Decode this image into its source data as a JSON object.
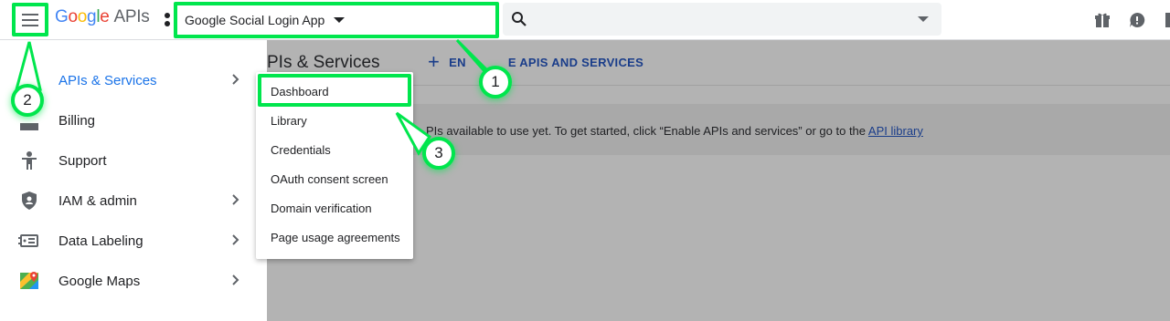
{
  "header": {
    "logo_google_letters": [
      "G",
      "o",
      "o",
      "g",
      "l",
      "e"
    ],
    "logo_apis": "APIs",
    "project_name": "Google Social Login App",
    "icons": [
      "menu-icon",
      "search-icon",
      "gift-icon",
      "notification-icon",
      "more-icon"
    ]
  },
  "content": {
    "page_title": "PIs & Services",
    "enable_plus": "+",
    "enable_label": "EN",
    "enable_label_end": "E APIS AND SERVICES",
    "info_text": "PIs available to use yet. To get started, click “Enable APIs and services” or go to the ",
    "info_link": "API library"
  },
  "nav": {
    "items": [
      {
        "label": "APIs & Services",
        "icon": "api-icon",
        "has_submenu": true,
        "active": true
      },
      {
        "label": "Billing",
        "icon": "billing-icon",
        "has_submenu": false
      },
      {
        "label": "Support",
        "icon": "support-icon",
        "has_submenu": false
      },
      {
        "label": "IAM & admin",
        "icon": "shield-icon",
        "has_submenu": true
      },
      {
        "label": "Data Labeling",
        "icon": "data-labeling-icon",
        "has_submenu": true
      },
      {
        "label": "Google Maps",
        "icon": "maps-icon",
        "has_submenu": true
      }
    ]
  },
  "submenu": {
    "items": [
      "Dashboard",
      "Library",
      "Credentials",
      "OAuth consent screen",
      "Domain verification",
      "Page usage agreements"
    ]
  },
  "callouts": [
    "1",
    "2",
    "3"
  ],
  "colors": {
    "highlight": "#00e64d",
    "active_link": "#1a73e8",
    "overlay": "#b3b3b3"
  }
}
